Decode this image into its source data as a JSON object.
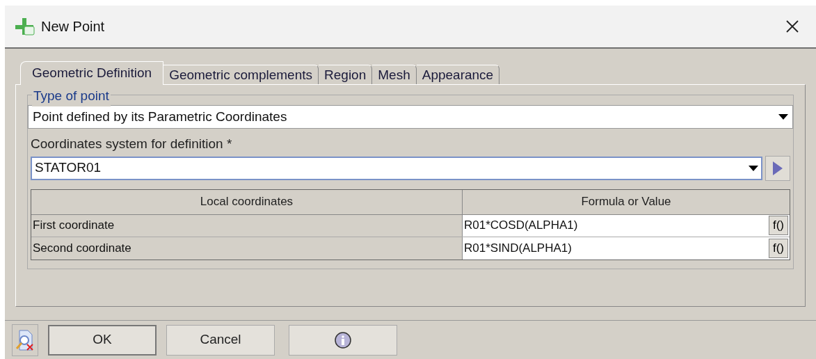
{
  "window": {
    "title": "New Point"
  },
  "tabs": [
    {
      "label": "Geometric Definition",
      "selected": true
    },
    {
      "label": "Geometric complements",
      "selected": false
    },
    {
      "label": "Region",
      "selected": false
    },
    {
      "label": "Mesh",
      "selected": false
    },
    {
      "label": "Appearance",
      "selected": false
    }
  ],
  "type_group": {
    "legend": "Type of point",
    "value": "Point defined by its Parametric Coordinates"
  },
  "coord_system": {
    "label": "Coordinates system for definition *",
    "value": "STATOR01"
  },
  "table": {
    "columns": [
      "Local coordinates",
      "Formula or Value"
    ],
    "rows": [
      {
        "name": "First coordinate",
        "value": "R01*COSD(ALPHA1)",
        "button": "f()"
      },
      {
        "name": "Second coordinate",
        "value": "R01*SIND(ALPHA1)",
        "button": "f()"
      }
    ]
  },
  "buttons": [
    {
      "label": "OK",
      "kind": "text",
      "default": true
    },
    {
      "label": "Cancel",
      "kind": "text",
      "default": false
    },
    {
      "kind": "info",
      "default": false
    }
  ]
}
